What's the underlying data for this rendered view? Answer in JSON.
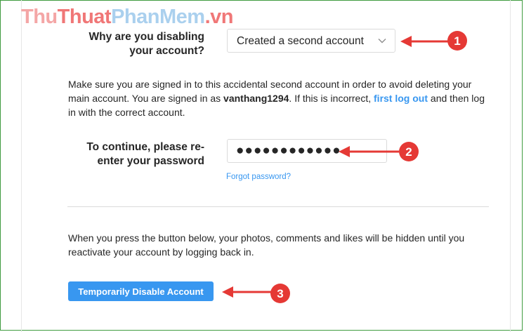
{
  "watermark": {
    "part1": "Thu",
    "part2": "Thuat",
    "part3": "PhanMem",
    "part4": ".vn"
  },
  "reason": {
    "label_line1": "Why are you disabling",
    "label_line2": "your account?",
    "selected": "Created a second account"
  },
  "info": {
    "text1": "Make sure you are signed in to this accidental second account in order to avoid deleting your main account. You are signed in as ",
    "username": "vanthang1294",
    "text2": ". If this is incorrect, ",
    "link": "first log out",
    "text3": " and then log in with the correct account."
  },
  "password": {
    "label_line1": "To continue, please re-",
    "label_line2": "enter your password",
    "masked_value": "●●●●●●●●●●●●",
    "forgot": "Forgot password?"
  },
  "notice": "When you press the button below, your photos, comments and likes will be hidden until you reactivate your account by logging back in.",
  "button": {
    "label": "Temporarily Disable Account"
  },
  "annotations": [
    "1",
    "2",
    "3"
  ],
  "colors": {
    "accent": "#3897f0",
    "annotation": "#e53935",
    "frame": "#3f9b3f"
  }
}
